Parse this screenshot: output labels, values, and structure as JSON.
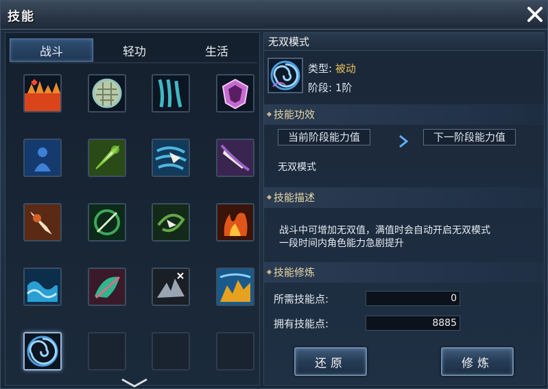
{
  "window": {
    "title": "技能"
  },
  "tabs": [
    {
      "label": "战斗",
      "active": true
    },
    {
      "label": "轻功",
      "active": false
    },
    {
      "label": "生活",
      "active": false
    }
  ],
  "skills": [
    {
      "icon": "flame-burst-icon",
      "color": "#d9441a"
    },
    {
      "icon": "turtle-shell-icon",
      "color": "#8fc7c2"
    },
    {
      "icon": "spirit-claw-icon",
      "color": "#3fb8c4"
    },
    {
      "icon": "violet-shield-icon",
      "color": "#c46ad0"
    },
    {
      "icon": "shadow-figure-icon",
      "color": "#3f7fd6"
    },
    {
      "icon": "green-blade-icon",
      "color": "#7ecb3a"
    },
    {
      "icon": "wind-slash-icon",
      "color": "#4cb7e0"
    },
    {
      "icon": "purple-cleave-icon",
      "color": "#9b62c9"
    },
    {
      "icon": "fire-dagger-icon",
      "color": "#d2622a"
    },
    {
      "icon": "green-whirl-icon",
      "color": "#3da858"
    },
    {
      "icon": "swirl-dart-icon",
      "color": "#62a84a"
    },
    {
      "icon": "inferno-icon",
      "color": "#e0561a"
    },
    {
      "icon": "wave-icon",
      "color": "#2a9fd4"
    },
    {
      "icon": "jade-fan-icon",
      "color": "#2fb68e"
    },
    {
      "icon": "steel-shards-icon",
      "color": "#9aa5b4"
    },
    {
      "icon": "golden-peaks-icon",
      "color": "#e6a21f"
    },
    {
      "icon": "vortex-icon",
      "color": "#4a9ee0"
    },
    {
      "icon": "empty-slot",
      "color": ""
    },
    {
      "icon": "empty-slot",
      "color": ""
    },
    {
      "icon": "empty-slot",
      "color": ""
    }
  ],
  "detail": {
    "name": "无双模式",
    "icon": "vortex-icon",
    "type_label": "类型:",
    "type_value": "被动",
    "stage_label": "阶段:",
    "stage_value": "1阶",
    "effect_header": "技能功效",
    "current_stage_label": "当前阶段能力值",
    "next_stage_label": "下一阶段能力值",
    "effect_text": "无双模式",
    "desc_header": "技能描述",
    "desc_line1": "战斗中可增加无双值，满值时会自动开启无双模式",
    "desc_line2": "一段时间内角色能力急剧提升",
    "train_header": "技能修炼",
    "required_label": "所需技能点:",
    "required_value": "0",
    "owned_label": "拥有技能点:",
    "owned_value": "8885",
    "restore_button": "还原",
    "train_button": "修炼"
  }
}
